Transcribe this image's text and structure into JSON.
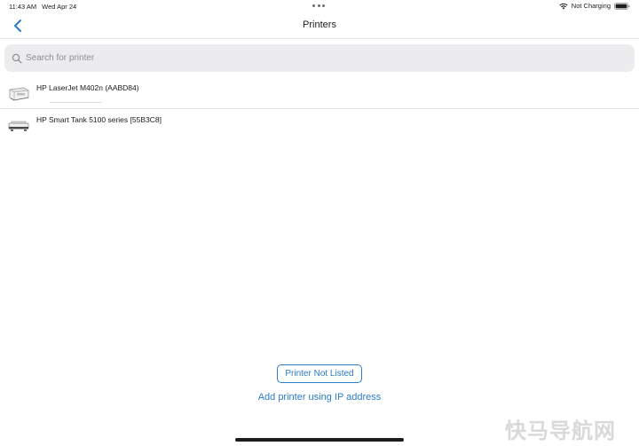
{
  "status_bar": {
    "time": "11:43 AM",
    "date": "Wed Apr 24",
    "charging_text": "Not Charging"
  },
  "nav": {
    "title": "Printers"
  },
  "search": {
    "placeholder": "Search for printer",
    "value": ""
  },
  "printers": [
    {
      "name": "HP LaserJet M402n (AABD84)",
      "icon": "laser-printer-icon"
    },
    {
      "name": "HP Smart Tank 5100 series [55B3C8]",
      "icon": "inkjet-printer-icon"
    }
  ],
  "actions": {
    "not_listed_label": "Printer Not Listed",
    "add_ip_label": "Add printer using IP address"
  },
  "watermark": {
    "text": "快马导航网"
  },
  "colors": {
    "accent": "#2a7cc7",
    "search_bg": "#ececee"
  }
}
